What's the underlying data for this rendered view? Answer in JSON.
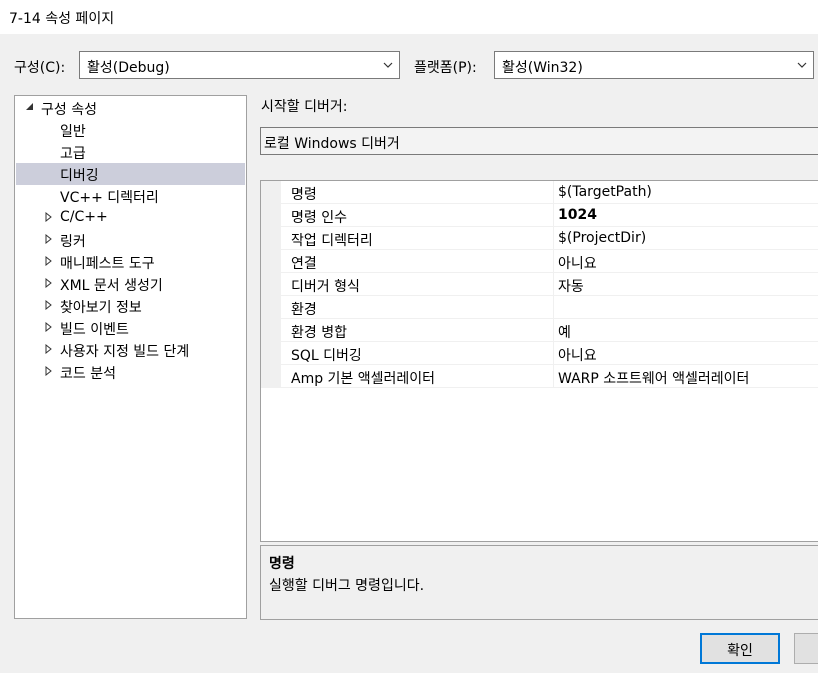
{
  "window": {
    "title": "7-14 속성 페이지"
  },
  "config": {
    "label": "구성(C):",
    "value": "활성(Debug)"
  },
  "platform": {
    "label": "플랫폼(P):",
    "value": "활성(Win32)"
  },
  "tree": {
    "root": "구성 속성",
    "items": [
      {
        "label": "일반",
        "expandable": false,
        "selected": false
      },
      {
        "label": "고급",
        "expandable": false,
        "selected": false
      },
      {
        "label": "디버깅",
        "expandable": false,
        "selected": true
      },
      {
        "label": "VC++ 디렉터리",
        "expandable": false,
        "selected": false
      },
      {
        "label": "C/C++",
        "expandable": true,
        "selected": false
      },
      {
        "label": "링커",
        "expandable": true,
        "selected": false
      },
      {
        "label": "매니페스트 도구",
        "expandable": true,
        "selected": false
      },
      {
        "label": "XML 문서 생성기",
        "expandable": true,
        "selected": false
      },
      {
        "label": "찾아보기 정보",
        "expandable": true,
        "selected": false
      },
      {
        "label": "빌드 이벤트",
        "expandable": true,
        "selected": false
      },
      {
        "label": "사용자 지정 빌드 단계",
        "expandable": true,
        "selected": false
      },
      {
        "label": "코드 분석",
        "expandable": true,
        "selected": false
      }
    ]
  },
  "debugger": {
    "label": "시작할 디버거:",
    "value": "로컬 Windows 디버거"
  },
  "properties": [
    {
      "name": "명령",
      "value": "$(TargetPath)",
      "bold": false
    },
    {
      "name": "명령 인수",
      "value": "1024",
      "bold": true
    },
    {
      "name": "작업 디렉터리",
      "value": "$(ProjectDir)",
      "bold": false
    },
    {
      "name": "연결",
      "value": "아니요",
      "bold": false
    },
    {
      "name": "디버거 형식",
      "value": "자동",
      "bold": false
    },
    {
      "name": "환경",
      "value": "",
      "bold": false
    },
    {
      "name": "환경 병합",
      "value": "예",
      "bold": false
    },
    {
      "name": "SQL 디버깅",
      "value": "아니요",
      "bold": false
    },
    {
      "name": "Amp 기본 액셀러레이터",
      "value": "WARP 소프트웨어 액셀러레이터",
      "bold": false
    }
  ],
  "description": {
    "title": "명령",
    "text": "실행할 디버그 명령입니다."
  },
  "buttons": {
    "ok": "확인"
  },
  "colors": {
    "accent": "#0078d7",
    "selection": "#cccedb"
  },
  "icons": [
    "chevron-down-icon",
    "expanded-triangle-icon",
    "collapsed-triangle-icon"
  ]
}
